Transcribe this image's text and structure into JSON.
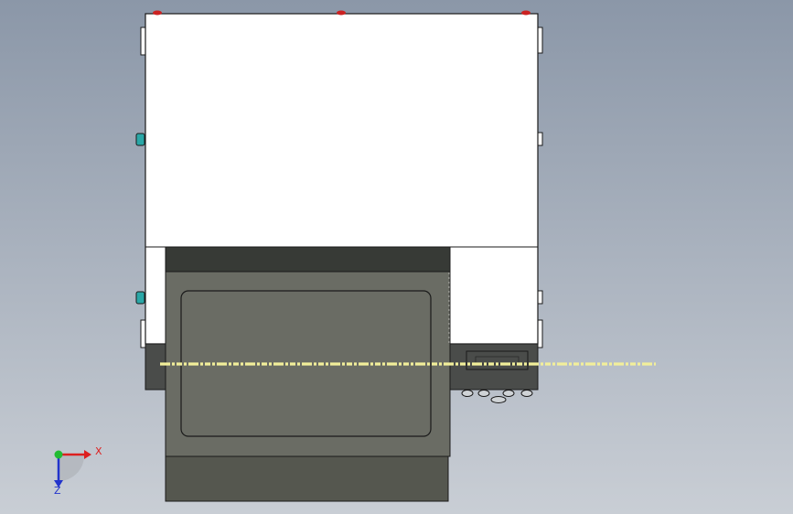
{
  "viewport": {
    "background_top": "#8b97a8",
    "background_bottom": "#c9ced5"
  },
  "model": {
    "body_color": "#ffffff",
    "outline_color": "#1a1a1a",
    "drawer_dark_color": "#373a36",
    "drawer_panel_color": "#6a6c64",
    "drawer_base_color": "#55574f",
    "side_panel_color": "#4a4c4a",
    "marker_red_color": "#cc2222",
    "marker_teal_color": "#2aa7a7",
    "dash_color": "#f2ef9a"
  },
  "triad": {
    "x_label": "X",
    "z_label": "Z",
    "x_color": "#dd1f1f",
    "y_color": "#22bb33",
    "z_color": "#2233cc"
  }
}
